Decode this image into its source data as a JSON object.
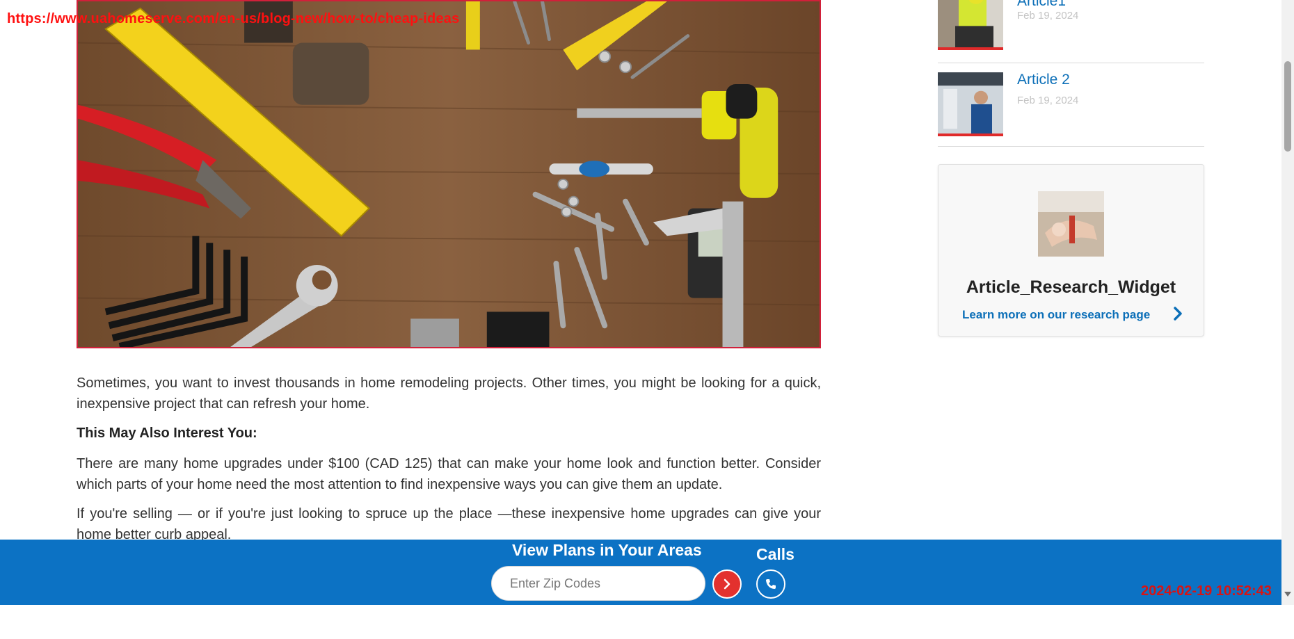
{
  "overlay": {
    "url": "https://www.uahomeserve.com/en-us/blog-new/how-to/cheap-ideas",
    "timestamp": "2024-02-19 10:52:43"
  },
  "article": {
    "hero_alt": "Tools on a wooden table",
    "paragraphs": [
      "Sometimes, you want to invest thousands in home remodeling projects. Other times, you might be looking for a quick, inexpensive project that can refresh your home.",
      "There are many home upgrades under $100 (CAD 125) that can make your home look and function better. Consider which parts of your home need the most attention to find inexpensive ways you can give them an update.",
      "If you're selling — or if you're just looking to spruce up the place —these inexpensive home upgrades can give your home better curb appeal."
    ],
    "subhead": "This May Also Interest You:"
  },
  "sidebar": {
    "items": [
      {
        "title": "Article1",
        "date": "Feb 19, 2024"
      },
      {
        "title": "Article 2",
        "date": "Feb 19, 2024"
      }
    ],
    "widget": {
      "title": "Article_Research_Widget",
      "link": "Learn more on our research page"
    }
  },
  "zip_bar": {
    "heading": "View Plans in Your Areas",
    "placeholder": "Enter Zip Codes",
    "calls_label": "Calls"
  },
  "colors": {
    "brand_blue": "#0c72c4",
    "link_blue": "#0c6fb8",
    "accent_red": "#e3312e"
  }
}
